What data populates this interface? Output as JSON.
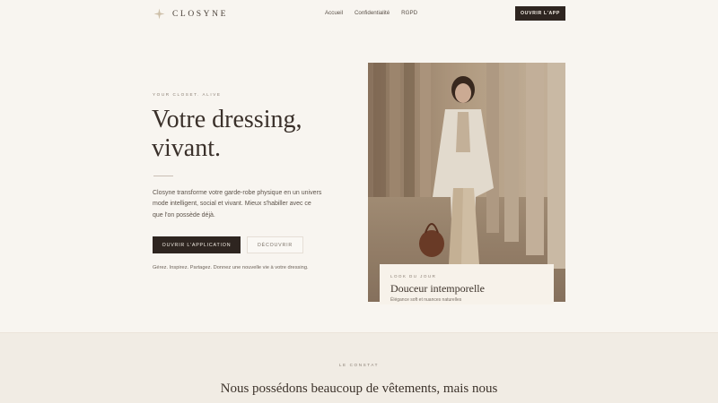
{
  "nav": {
    "brand": "CLOSYNE",
    "links": [
      "Accueil",
      "Confidentialité",
      "RGPD"
    ],
    "cta": "OUVRIR L'APP"
  },
  "hero": {
    "eyebrow": "YOUR CLOSET. ALIVE",
    "title_line1": "Votre dressing,",
    "title_line2": "vivant.",
    "description": "Closyne transforme votre garde-robe physique en un univers mode intelligent, social et vivant. Mieux s'habiller avec ce que l'on possède déjà.",
    "primary_button": "OUVRIR L'APPLICATION",
    "secondary_button": "DÉCOUVRIR",
    "note": "Gérez. Inspirez. Partagez. Donnez une nouvelle vie à votre dressing."
  },
  "look": {
    "eyebrow": "LOOK DU JOUR",
    "title": "Douceur intemporelle",
    "subtitle": "Élégance soft et nuances naturelles"
  },
  "section2": {
    "eyebrow": "LE CONSTAT",
    "title": "Nous possédons beaucoup de vêtements, mais nous"
  },
  "colors": {
    "background": "#f8f5f0",
    "dark_button": "#2e2520",
    "section_background": "#f1ece4"
  },
  "icons": {
    "logo": "star-mark-icon"
  }
}
